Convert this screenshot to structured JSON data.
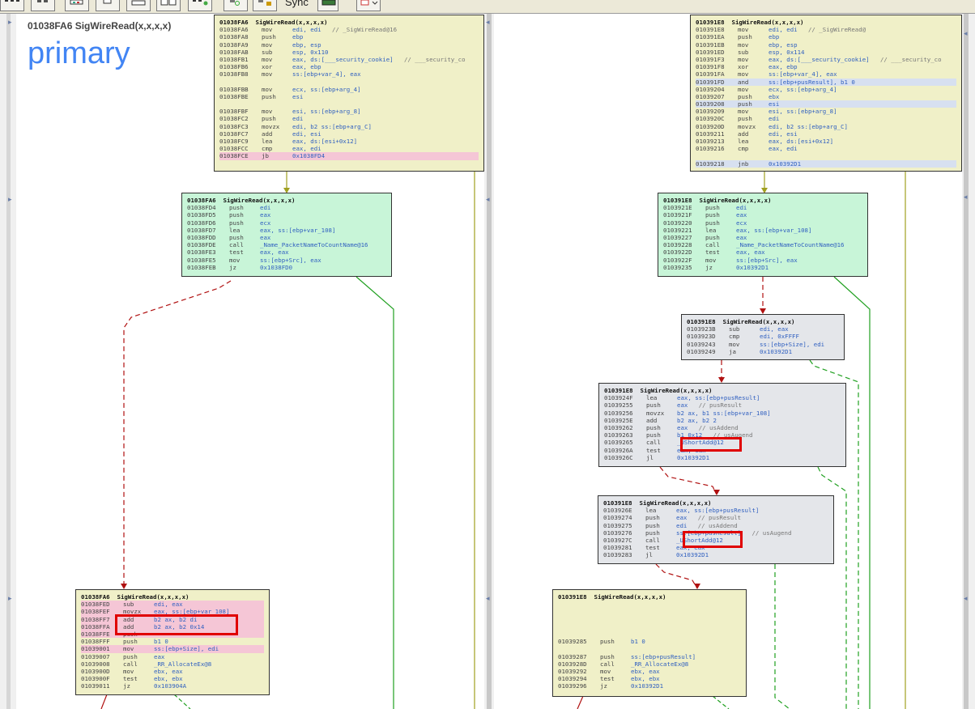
{
  "toolbar": {
    "sync_label": "Sync",
    "buttons": [
      "layout-hierarchical-icon",
      "layout-orthogonal-icon",
      "layout-circular-icon",
      "graph-tree-icon",
      "graph-flow-icon",
      "graph-proximity-icon",
      "graph-fit-icon",
      "graph-refresh-icon",
      "graph-lock-icon",
      "sync-screen-icon"
    ]
  },
  "primary": {
    "header": "01038FA6 SigWireRead(x,x,x,x)",
    "title": "primary",
    "blocks": [
      {
        "title": "01038FA6  SigWireRead(x,x,x,x)",
        "rows": [
          [
            "01038FA6",
            "mov",
            "edi, edi",
            "// _SigWireRead@16",
            ""
          ],
          [
            "01038FA8",
            "push",
            "ebp",
            "",
            ""
          ],
          [
            "01038FA9",
            "mov",
            "ebp, esp",
            "",
            ""
          ],
          [
            "01038FAB",
            "sub",
            "esp, 0x110",
            "",
            ""
          ],
          [
            "01038FB1",
            "mov",
            "eax, ds:[___security_cookie]",
            "// ___security_co",
            ""
          ],
          [
            "01038FB6",
            "xor",
            "eax, ebp",
            "",
            ""
          ],
          [
            "01038FB8",
            "mov",
            "ss:[ebp+var_4], eax",
            "",
            ""
          ],
          [
            "",
            "",
            "",
            "",
            ""
          ],
          [
            "01038FBB",
            "mov",
            "ecx, ss:[ebp+arg_4]",
            "",
            ""
          ],
          [
            "01038FBE",
            "push",
            "esi",
            "",
            ""
          ],
          [
            "",
            "",
            "",
            "",
            ""
          ],
          [
            "01038FBF",
            "mov",
            "esi, ss:[ebp+arg_8]",
            "",
            ""
          ],
          [
            "01038FC2",
            "push",
            "edi",
            "",
            ""
          ],
          [
            "01038FC3",
            "movzx",
            "edi, b2 ss:[ebp+arg_C]",
            "",
            ""
          ],
          [
            "01038FC7",
            "add",
            "edi, esi",
            "",
            ""
          ],
          [
            "01038FC9",
            "lea",
            "eax, ds:[esi+0x12]",
            "",
            ""
          ],
          [
            "01038FCC",
            "cmp",
            "eax, edi",
            "",
            ""
          ],
          [
            "01038FCE",
            "jb",
            "0x1038FD4",
            "",
            "pink"
          ]
        ]
      },
      {
        "title": "01038FA6  SigWireRead(x,x,x,x)",
        "rows": [
          [
            "01038FD4",
            "push",
            "edi",
            "",
            ""
          ],
          [
            "01038FD5",
            "push",
            "eax",
            "",
            ""
          ],
          [
            "01038FD6",
            "push",
            "ecx",
            "",
            ""
          ],
          [
            "01038FD7",
            "lea",
            "eax, ss:[ebp+var_108]",
            "",
            ""
          ],
          [
            "01038FDD",
            "push",
            "eax",
            "",
            ""
          ],
          [
            "01038FDE",
            "call",
            "_Name_PacketNameToCountName@16",
            "",
            ""
          ],
          [
            "01038FE3",
            "test",
            "eax, eax",
            "",
            ""
          ],
          [
            "01038FE5",
            "mov",
            "ss:[ebp+Src], eax",
            "",
            ""
          ],
          [
            "01038FEB",
            "jz",
            "0x1038FD0",
            "",
            ""
          ]
        ]
      },
      {
        "title": "01038FA6  SigWireRead(x,x,x,x)",
        "rows": [
          [
            "01038FED",
            "sub",
            "edi, eax",
            "",
            "pink"
          ],
          [
            "01038FEF",
            "movzx",
            "eax, ss:[ebp+var_108]",
            "",
            "pink"
          ],
          [
            "01038FF7",
            "add",
            "b2 ax, b2 di",
            "",
            "pink"
          ],
          [
            "01038FFA",
            "add",
            "b2 ax, b2 0x14",
            "",
            "pink"
          ],
          [
            "01038FFE",
            "push",
            "",
            "",
            "pink"
          ],
          [
            "01038FFF",
            "push",
            "b1 0",
            "",
            ""
          ],
          [
            "01039001",
            "mov",
            "ss:[ebp+Size], edi",
            "",
            "pink"
          ],
          [
            "01039007",
            "push",
            "eax",
            "",
            ""
          ],
          [
            "01039008",
            "call",
            "_RR_AllocateEx@8",
            "",
            ""
          ],
          [
            "0103900D",
            "mov",
            "ebx, eax",
            "",
            ""
          ],
          [
            "0103900F",
            "test",
            "ebx, ebx",
            "",
            ""
          ],
          [
            "01039011",
            "jz",
            "0x103904A",
            "",
            ""
          ]
        ]
      }
    ]
  },
  "secondary": {
    "blocks": [
      {
        "title": "010391E8  SigWireRead(x,x,x,x)",
        "rows": [
          [
            "010391E8",
            "mov",
            "edi, edi",
            "// _SigWireRead@",
            ""
          ],
          [
            "010391EA",
            "push",
            "ebp",
            "",
            ""
          ],
          [
            "010391EB",
            "mov",
            "ebp, esp",
            "",
            ""
          ],
          [
            "010391ED",
            "sub",
            "esp, 0x114",
            "",
            ""
          ],
          [
            "010391F3",
            "mov",
            "eax, ds:[___security_cookie]",
            "// ___security_co",
            ""
          ],
          [
            "010391F8",
            "xor",
            "eax, ebp",
            "",
            ""
          ],
          [
            "010391FA",
            "mov",
            "ss:[ebp+var_4], eax",
            "",
            ""
          ],
          [
            "010391FD",
            "and",
            "ss:[ebp+pusResult], b1 0",
            "",
            "blue"
          ],
          [
            "01039204",
            "mov",
            "ecx, ss:[ebp+arg_4]",
            "",
            ""
          ],
          [
            "01039207",
            "push",
            "ebx",
            "",
            ""
          ],
          [
            "01039208",
            "push",
            "esi",
            "",
            "blue"
          ],
          [
            "01039209",
            "mov",
            "esi, ss:[ebp+arg_8]",
            "",
            ""
          ],
          [
            "0103920C",
            "push",
            "edi",
            "",
            ""
          ],
          [
            "0103920D",
            "movzx",
            "edi, b2 ss:[ebp+arg_C]",
            "",
            ""
          ],
          [
            "01039211",
            "add",
            "edi, esi",
            "",
            ""
          ],
          [
            "01039213",
            "lea",
            "eax, ds:[esi+0x12]",
            "",
            ""
          ],
          [
            "01039216",
            "cmp",
            "eax, edi",
            "",
            ""
          ],
          [
            "",
            "",
            "",
            "",
            ""
          ],
          [
            "01039218",
            "jnb",
            "0x10392D1",
            "",
            "blue"
          ]
        ]
      },
      {
        "title": "010391E8  SigWireRead(x,x,x,x)",
        "rows": [
          [
            "0103921E",
            "push",
            "edi",
            "",
            ""
          ],
          [
            "0103921F",
            "push",
            "eax",
            "",
            ""
          ],
          [
            "01039220",
            "push",
            "ecx",
            "",
            ""
          ],
          [
            "01039221",
            "lea",
            "eax, ss:[ebp+var_108]",
            "",
            ""
          ],
          [
            "01039227",
            "push",
            "eax",
            "",
            ""
          ],
          [
            "01039228",
            "call",
            "_Name_PacketNameToCountName@16",
            "",
            ""
          ],
          [
            "0103922D",
            "test",
            "eax, eax",
            "",
            ""
          ],
          [
            "0103922F",
            "mov",
            "ss:[ebp+Src], eax",
            "",
            ""
          ],
          [
            "01039235",
            "jz",
            "0x10392D1",
            "",
            ""
          ]
        ]
      },
      {
        "title": "010391E8  SigWireRead(x,x,x,x)",
        "rows": [
          [
            "0103923B",
            "sub",
            "edi, eax",
            "",
            ""
          ],
          [
            "0103923D",
            "cmp",
            "edi, 0xFFFF",
            "",
            ""
          ],
          [
            "01039243",
            "mov",
            "ss:[ebp+Size], edi",
            "",
            ""
          ],
          [
            "01039249",
            "ja",
            "0x10392D1",
            "",
            ""
          ]
        ]
      },
      {
        "title": "010391E8  SigWireRead(x,x,x,x)",
        "rows": [
          [
            "0103924F",
            "lea",
            "eax, ss:[ebp+pusResult]",
            "",
            ""
          ],
          [
            "01039255",
            "push",
            "eax",
            "// pusResult",
            ""
          ],
          [
            "01039256",
            "movzx",
            "b2 ax, b1 ss:[ebp+var_108]",
            "",
            ""
          ],
          [
            "0103925E",
            "add",
            "b2 ax, b2 2",
            "",
            ""
          ],
          [
            "01039262",
            "push",
            "eax",
            "// usAddend",
            ""
          ],
          [
            "01039263",
            "push",
            "b1 0x12",
            "// usAugend",
            ""
          ],
          [
            "01039265",
            "call",
            "_UShortAdd@12",
            "",
            ""
          ],
          [
            "0103926A",
            "test",
            "eax, eax",
            "",
            ""
          ],
          [
            "0103926C",
            "jl",
            "0x10392D1",
            "",
            ""
          ]
        ]
      },
      {
        "title": "010391E8  SigWireRead(x,x,x,x)",
        "rows": [
          [
            "0103926E",
            "lea",
            "eax, ss:[ebp+pusResult]",
            "",
            ""
          ],
          [
            "01039274",
            "push",
            "eax",
            "// pusResult",
            ""
          ],
          [
            "01039275",
            "push",
            "edi",
            "// usAddend",
            ""
          ],
          [
            "01039276",
            "push",
            "ss:[ebp+pusResult]",
            "// usAugend",
            ""
          ],
          [
            "0103927C",
            "call",
            "_UShortAdd@12",
            "",
            ""
          ],
          [
            "01039281",
            "test",
            "eax, eax",
            "",
            ""
          ],
          [
            "01039283",
            "jl",
            "0x10392D1",
            "",
            ""
          ]
        ]
      },
      {
        "title": "010391E8  SigWireRead(x,x,x,x)",
        "rows": [
          [
            "",
            "",
            "",
            "",
            ""
          ],
          [
            "",
            "",
            "",
            "",
            ""
          ],
          [
            "",
            "",
            "",
            "",
            ""
          ],
          [
            "",
            "",
            "",
            "",
            ""
          ],
          [
            "",
            "",
            "",
            "",
            ""
          ],
          [
            "01039285",
            "push",
            "b1 0",
            "",
            ""
          ],
          [
            "",
            "",
            "",
            "",
            ""
          ],
          [
            "01039287",
            "push",
            "ss:[ebp+pusResult]",
            "",
            ""
          ],
          [
            "0103928D",
            "call",
            "_RR_AllocateEx@8",
            "",
            ""
          ],
          [
            "01039292",
            "mov",
            "ebx, eax",
            "",
            ""
          ],
          [
            "01039294",
            "test",
            "ebx, ebx",
            "",
            ""
          ],
          [
            "01039296",
            "jz",
            "0x10392D1",
            "",
            ""
          ]
        ]
      }
    ]
  },
  "colors": {
    "accent": "#4285f4",
    "block_yellow": "#f0f0c8",
    "block_green": "#c8f5d8",
    "block_gray": "#e4e6ea",
    "highlight_red": "#e00000",
    "edge_red": "#b01010",
    "edge_green": "#20a020",
    "edge_olive": "#a0a020"
  }
}
